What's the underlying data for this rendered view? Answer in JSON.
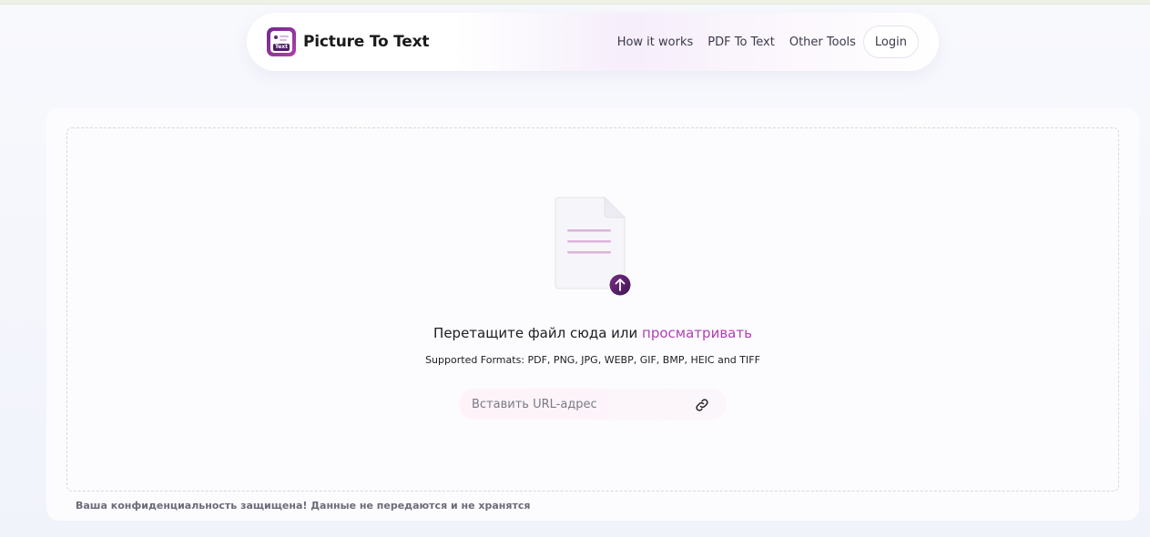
{
  "header": {
    "brand_name": "Picture To Text",
    "logo_tag": "Text",
    "nav": {
      "how_it_works": "How it works",
      "pdf_to_text": "PDF To Text",
      "other_tools": "Other Tools",
      "login": "Login"
    }
  },
  "upload": {
    "drop_prompt": "Перетащите файл сюда или",
    "browse_label": "просматривать",
    "supported_formats": "Supported Formats: PDF, PNG, JPG, WEBP, GIF, BMP, HEIC and TIFF",
    "url_placeholder": "Вставить URL-адрес",
    "url_value": ""
  },
  "footer": {
    "privacy_note": "Ваша конфиденциальность защищена! Данные не передаются и не хранятся"
  },
  "colors": {
    "accent": "#b13fb5",
    "logo_dark": "#5a2a7a",
    "upload_badge": "#4a1a5e"
  },
  "icons": {
    "logo": "picture-to-text-logo-icon",
    "file": "document-file-icon",
    "upload": "upload-arrow-icon",
    "link": "link-icon"
  }
}
